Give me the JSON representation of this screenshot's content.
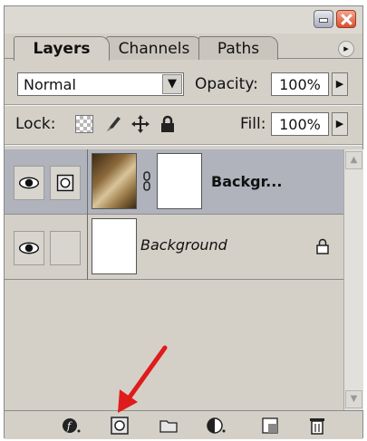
{
  "window": {
    "min_icon": "minimize-icon",
    "close_icon": "close-icon"
  },
  "tabs": [
    {
      "label": "Layers",
      "active": true
    },
    {
      "label": "Channels",
      "active": false
    },
    {
      "label": "Paths",
      "active": false
    }
  ],
  "panel_menu_icon": "▸",
  "blend": {
    "mode": "Normal",
    "opacity_label": "Opacity:",
    "opacity_value": "100%"
  },
  "lock": {
    "label": "Lock:",
    "fill_label": "Fill:",
    "fill_value": "100%",
    "icons": [
      "lock-transparent-pixels-icon",
      "lock-image-pixels-icon",
      "lock-position-icon",
      "lock-all-icon"
    ]
  },
  "layers": [
    {
      "name": "Backgr...",
      "selected": true,
      "has_mask": true,
      "style": "bold"
    },
    {
      "name": "Background",
      "selected": false,
      "has_mask": false,
      "style": "italic",
      "locked": true
    }
  ],
  "toolbar_icons": [
    "layer-style-icon",
    "add-layer-mask-icon",
    "new-group-icon",
    "adjustment-layer-icon",
    "new-layer-icon",
    "delete-layer-icon"
  ],
  "colors": {
    "panel": "#d4d0c8",
    "selected_row": "#b0b3bc",
    "annotation_arrow": "#e01b1b"
  }
}
